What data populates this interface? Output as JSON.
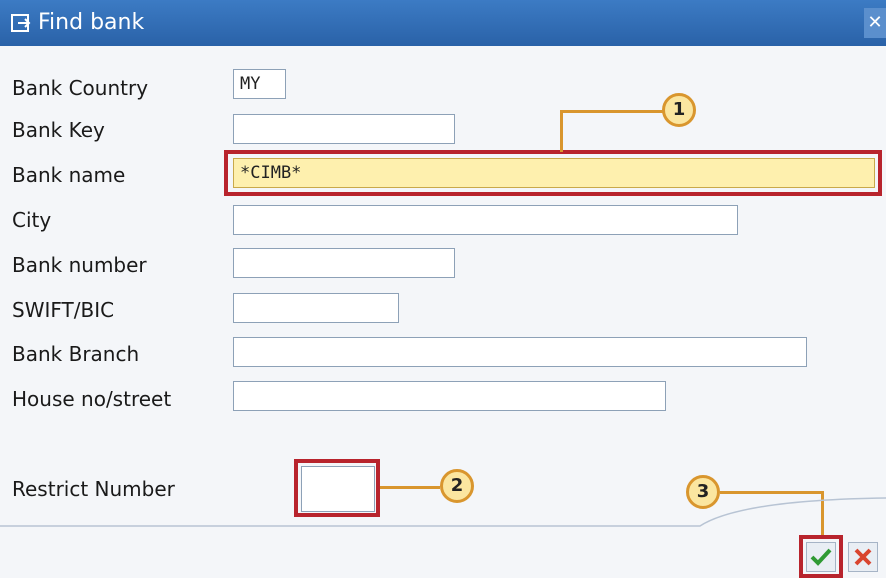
{
  "window": {
    "title": "Find bank"
  },
  "fields": {
    "bank_country": {
      "label": "Bank Country",
      "value": "MY"
    },
    "bank_key": {
      "label": "Bank Key",
      "value": ""
    },
    "bank_name": {
      "label": "Bank name",
      "value": "*CIMB*"
    },
    "city": {
      "label": "City",
      "value": ""
    },
    "bank_number": {
      "label": "Bank number",
      "value": ""
    },
    "swift_bic": {
      "label": "SWIFT/BIC",
      "value": ""
    },
    "bank_branch": {
      "label": "Bank Branch",
      "value": ""
    },
    "house_no_street": {
      "label": "House no/street",
      "value": ""
    },
    "restrict_number": {
      "label": "Restrict Number",
      "value": ""
    }
  },
  "callouts": [
    "1",
    "2",
    "3"
  ],
  "colors": {
    "title_bar": "#2a62a8",
    "highlight": "#fef0ae",
    "callout_border": "#d9962e",
    "focus_box": "#b8242d"
  },
  "icons": {
    "title": "window-icon",
    "close": "close-icon",
    "ok": "checkmark-icon",
    "cancel": "cancel-icon"
  }
}
